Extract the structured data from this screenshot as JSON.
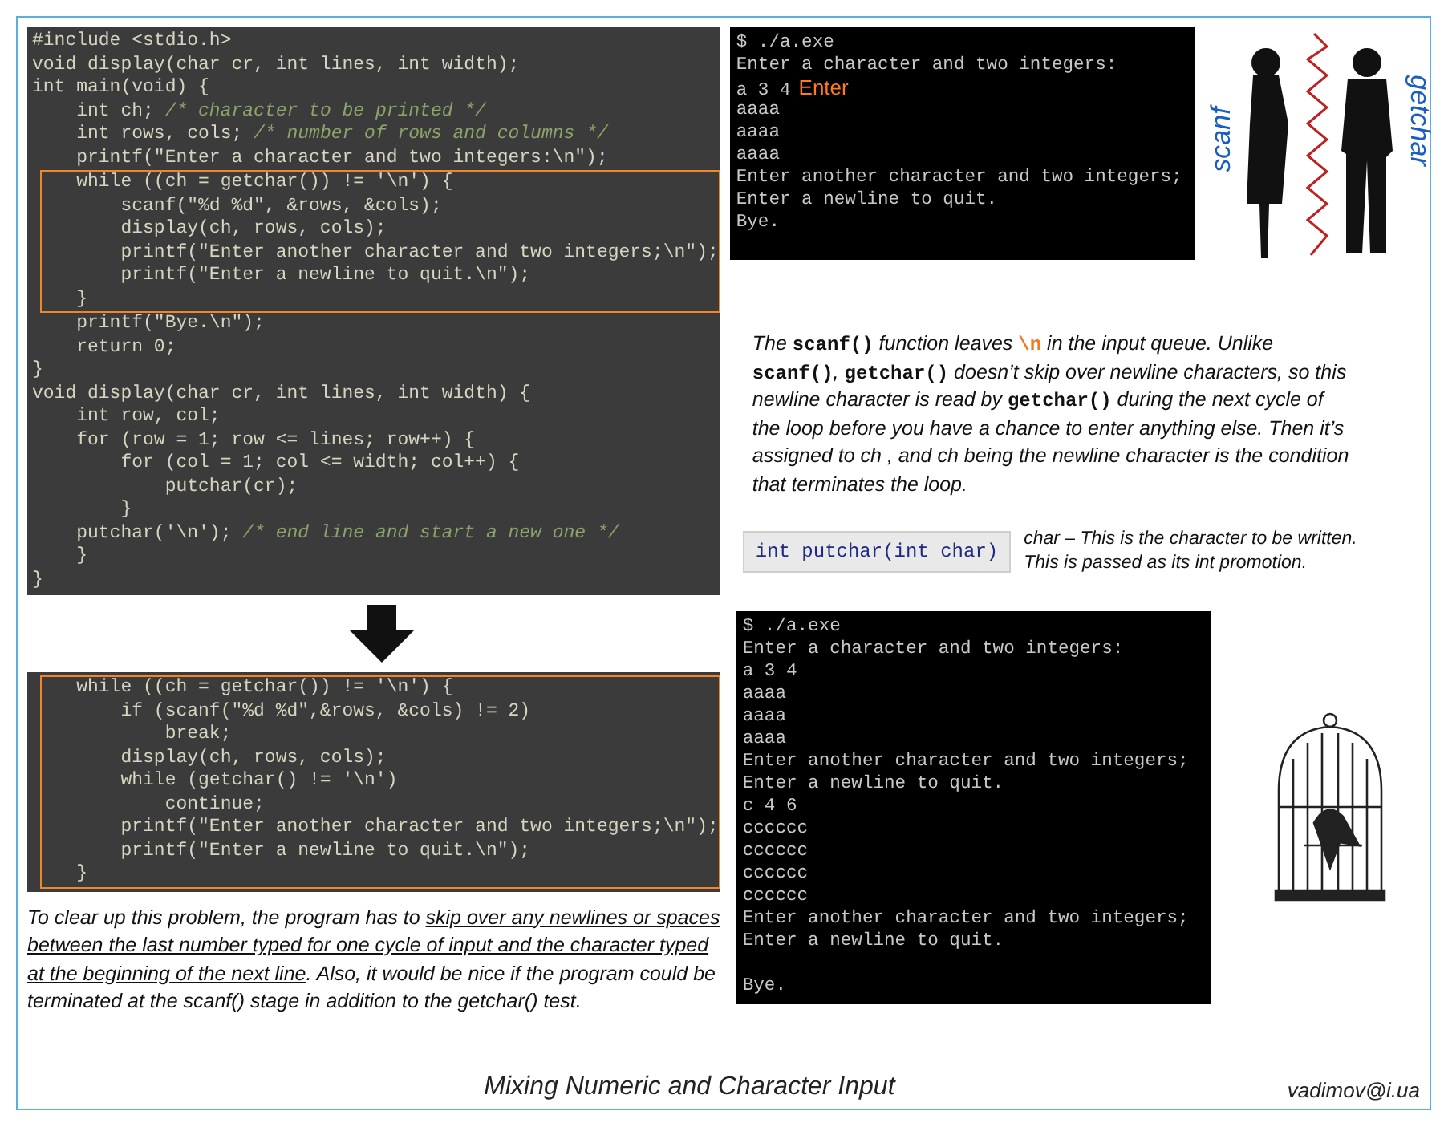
{
  "code_top": {
    "segments": [
      {
        "boxed": false,
        "lines": [
          {
            "code": "#include <stdio.h>"
          },
          {
            "code": "void display(char cr, int lines, int width);"
          },
          {
            "code": "int main(void) {"
          },
          {
            "code": "    int ch; ",
            "comment": "/* character to be printed */"
          },
          {
            "code": "    int rows, cols; ",
            "comment": "/* number of rows and columns */"
          },
          {
            "code": "    printf(\"Enter a character and two integers:\\n\");"
          }
        ]
      },
      {
        "boxed": true,
        "lines": [
          {
            "code": "    while ((ch = getchar()) != '\\n') {"
          },
          {
            "code": "        scanf(\"%d %d\", &rows, &cols);"
          },
          {
            "code": "        display(ch, rows, cols);"
          },
          {
            "code": "        printf(\"Enter another character and two integers;\\n\");"
          },
          {
            "code": "        printf(\"Enter a newline to quit.\\n\");"
          },
          {
            "code": "    }"
          }
        ]
      },
      {
        "boxed": false,
        "lines": [
          {
            "code": "    printf(\"Bye.\\n\");"
          },
          {
            "code": "    return 0;"
          },
          {
            "code": "}"
          },
          {
            "code": "void display(char cr, int lines, int width) {"
          },
          {
            "code": "    int row, col;"
          },
          {
            "code": "    for (row = 1; row <= lines; row++) {"
          },
          {
            "code": "        for (col = 1; col <= width; col++) {"
          },
          {
            "code": "            putchar(cr);"
          },
          {
            "code": "        }"
          },
          {
            "code": "    putchar('\\n'); ",
            "comment": "/* end line and start a new one */"
          },
          {
            "code": "    }"
          },
          {
            "code": "}"
          }
        ]
      }
    ]
  },
  "terminal_top": {
    "lines": [
      {
        "kind": "output",
        "text": "$ ./a.exe"
      },
      {
        "kind": "output",
        "text": "Enter a character and two integers:"
      },
      {
        "kind": "output",
        "text": "a 3 4",
        "note": "Enter"
      },
      {
        "kind": "output",
        "text": "aaaa"
      },
      {
        "kind": "output",
        "text": "aaaa"
      },
      {
        "kind": "output",
        "text": "aaaa"
      },
      {
        "kind": "output",
        "text": "Enter another character and two integers;"
      },
      {
        "kind": "output",
        "text": "Enter a newline to quit."
      },
      {
        "kind": "output",
        "text": "Bye."
      }
    ]
  },
  "illustration": {
    "left_label": "scanf",
    "right_label": "getchar"
  },
  "explanation": {
    "segments": [
      {
        "kind": "text",
        "text": "The "
      },
      {
        "kind": "code",
        "text": "scanf()"
      },
      {
        "kind": "text",
        "text": "  function leaves "
      },
      {
        "kind": "escape",
        "text": "\\n"
      },
      {
        "kind": "text",
        "text": " in the input queue. Unlike "
      },
      {
        "kind": "code",
        "text": "scanf()"
      },
      {
        "kind": "text",
        "text": ", "
      },
      {
        "kind": "code",
        "text": "getchar()"
      },
      {
        "kind": "text",
        "text": " doesn’t skip over newline characters, so this newline character is read by "
      },
      {
        "kind": "code",
        "text": "getchar()"
      },
      {
        "kind": "text",
        "text": " during the next cycle of the loop before you have a chance to enter anything else. Then it’s assigned to ch , and ch being the newline character is the condition that terminates the loop."
      }
    ]
  },
  "putchar": {
    "signature": "int putchar(int char)",
    "description": [
      "char – This is the character to be written.",
      "This is passed as its int promotion."
    ]
  },
  "code_bottom": {
    "segments": [
      {
        "boxed": true,
        "lines": [
          {
            "code": "    while ((ch = getchar()) != '\\n') {"
          },
          {
            "code": "        if (scanf(\"%d %d\",&rows, &cols) != 2)"
          },
          {
            "code": "            break;"
          },
          {
            "code": "        display(ch, rows, cols);"
          },
          {
            "code": "        while (getchar() != '\\n')"
          },
          {
            "code": "            continue;"
          },
          {
            "code": "        printf(\"Enter another character and two integers;\\n\");"
          },
          {
            "code": "        printf(\"Enter a newline to quit.\\n\");"
          },
          {
            "code": "    }"
          }
        ]
      }
    ]
  },
  "terminal_bottom": {
    "lines": [
      {
        "kind": "output",
        "text": "$ ./a.exe"
      },
      {
        "kind": "output",
        "text": "Enter a character and two integers:"
      },
      {
        "kind": "output",
        "text": "a 3 4"
      },
      {
        "kind": "output",
        "text": "aaaa"
      },
      {
        "kind": "output",
        "text": "aaaa"
      },
      {
        "kind": "output",
        "text": "aaaa"
      },
      {
        "kind": "output",
        "text": "Enter another character and two integers;"
      },
      {
        "kind": "output",
        "text": "Enter a newline to quit."
      },
      {
        "kind": "output",
        "text": "c 4 6"
      },
      {
        "kind": "output",
        "text": "cccccc"
      },
      {
        "kind": "output",
        "text": "cccccc"
      },
      {
        "kind": "output",
        "text": "cccccc"
      },
      {
        "kind": "output",
        "text": "cccccc"
      },
      {
        "kind": "output",
        "text": "Enter another character and two integers;"
      },
      {
        "kind": "output",
        "text": "Enter a newline to quit."
      },
      {
        "kind": "blank"
      },
      {
        "kind": "output",
        "text": "Bye."
      }
    ]
  },
  "solution": {
    "segments": [
      {
        "kind": "text",
        "text": "To clear up this problem, the program has to "
      },
      {
        "kind": "underline",
        "text": "skip over any newlines or spaces between the last number typed for one cycle of input and the character typed at the beginning of the next line"
      },
      {
        "kind": "text",
        "text": ". Also, it would be nice if the program could be terminated at the scanf() stage in addition to the getchar() test."
      }
    ]
  },
  "footer": {
    "title": "Mixing Numeric and Character Input",
    "author": "vadimov@i.ua"
  }
}
